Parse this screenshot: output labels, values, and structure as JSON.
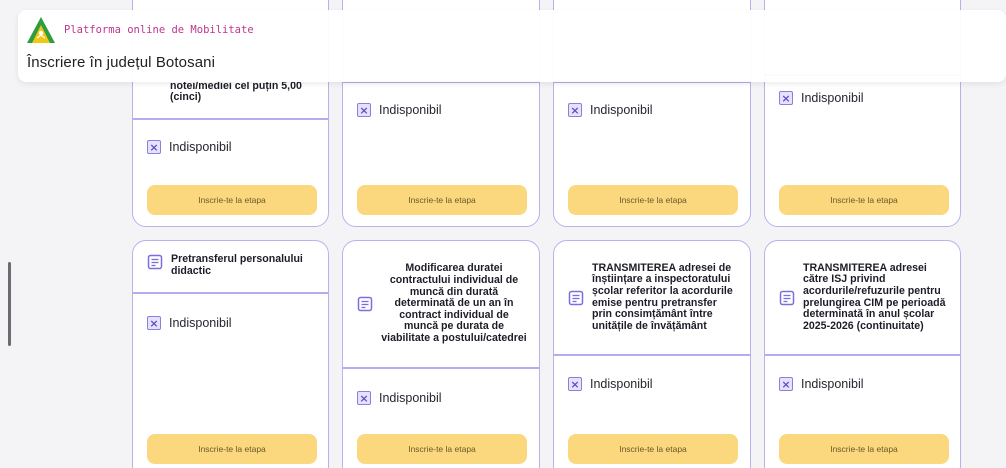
{
  "header": {
    "brand": "Platforma online de Mobilitate",
    "county_title": "Înscriere în județul Botosani"
  },
  "status_label": "Indisponibil",
  "button_label": "Inscrie-te la etapa",
  "top_row": [
    {
      "title": "notei/mediei cel puțin 5,00 (cinci)"
    },
    {
      "title": ""
    },
    {
      "title": ""
    },
    {
      "title": ""
    }
  ],
  "bottom_row": [
    {
      "title": "Pretransferul personalului didactic"
    },
    {
      "title": "Modificarea duratei contractului individual de muncă din durată determinată de un an în contract individual de muncă pe durata de viabilitate a postului/catedrei"
    },
    {
      "title": "TRANSMITEREA adresei de înștiințare a inspectoratului școlar referitor la acordurile emise pentru pretransfer prin consimțământ între unitățile de învățământ"
    },
    {
      "title": "TRANSMITEREA adresei către ISJ privind acordurile/refuzurile pentru prelungirea CIM pe perioadă determinată în anul școlar 2025-2026 (continuitate)"
    }
  ],
  "colors": {
    "accent": "#b3acef",
    "button": "#fbd77d",
    "brand_text": "#c0358f"
  }
}
